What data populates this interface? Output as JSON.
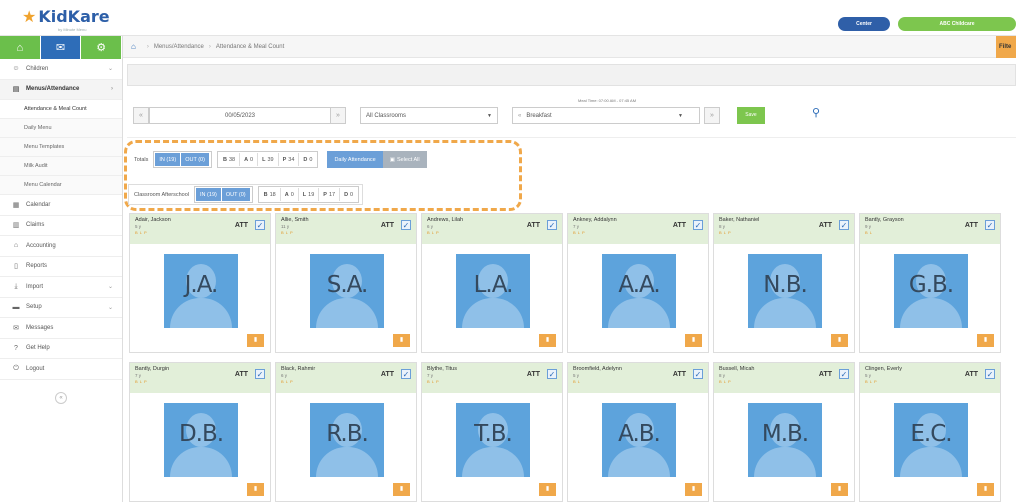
{
  "header": {
    "logo": "KidKare",
    "logo_sub": "by Minute Menu",
    "center_pill": "Center",
    "provider_pill": "ABC Childcare"
  },
  "sidebar": {
    "tabs": [
      {
        "icon": "home-icon",
        "glyph": "⌂"
      },
      {
        "icon": "mail-icon",
        "glyph": "✉"
      },
      {
        "icon": "gears-icon",
        "glyph": "⚙"
      }
    ],
    "items": [
      {
        "label": "Children",
        "icon": "child-icon",
        "glyph": "☺",
        "has_chevron": true
      },
      {
        "label": "Menus/Attendance",
        "icon": "menu-icon",
        "glyph": "▤",
        "has_chevron": true,
        "active": true
      },
      {
        "label": "Calendar",
        "icon": "calendar-icon",
        "glyph": "▦",
        "has_chevron": false
      },
      {
        "label": "Claims",
        "icon": "claims-icon",
        "glyph": "▥",
        "has_chevron": false
      },
      {
        "label": "Accounting",
        "icon": "bank-icon",
        "glyph": "⌂",
        "has_chevron": false
      },
      {
        "label": "Reports",
        "icon": "report-icon",
        "glyph": "▯",
        "has_chevron": false
      },
      {
        "label": "Import",
        "icon": "import-icon",
        "glyph": "⤓",
        "has_chevron": true
      },
      {
        "label": "Setup",
        "icon": "setup-icon",
        "glyph": "▬",
        "has_chevron": true
      },
      {
        "label": "Messages",
        "icon": "messages-icon",
        "glyph": "✉",
        "has_chevron": false
      },
      {
        "label": "Get Help",
        "icon": "help-icon",
        "glyph": "?",
        "has_chevron": false
      },
      {
        "label": "Logout",
        "icon": "logout-icon",
        "glyph": "⏻",
        "has_chevron": false
      }
    ],
    "sub_items": [
      {
        "label": "Attendance & Meal Count",
        "active": true
      },
      {
        "label": "Daily Menu"
      },
      {
        "label": "Menu Templates"
      },
      {
        "label": "Milk Audit"
      },
      {
        "label": "Menu Calendar"
      }
    ]
  },
  "breadcrumb": {
    "items": [
      "Menus/Attendance",
      "Attendance & Meal Count"
    ],
    "filter_label": "Filte"
  },
  "controls": {
    "date": "00/05/2023",
    "classroom": "All Classrooms",
    "meal": "Breakfast",
    "meal_time": "Meal Time: 07:00 AM - 07:45 AM",
    "save_label": "Save"
  },
  "totals": {
    "label": "Totals",
    "in": "IN (19)",
    "out": "OUT (0)",
    "counts": [
      {
        "k": "B",
        "v": "38"
      },
      {
        "k": "A",
        "v": "0"
      },
      {
        "k": "L",
        "v": "39"
      },
      {
        "k": "P",
        "v": "34"
      },
      {
        "k": "D",
        "v": "0"
      }
    ],
    "daily_attendance": "Daily Attendance",
    "select_all": "Select All"
  },
  "classroom_row": {
    "label": "Classroom Afterschool",
    "in": "IN (19)",
    "out": "OUT (0)",
    "counts": [
      {
        "k": "B",
        "v": "18"
      },
      {
        "k": "A",
        "v": "0"
      },
      {
        "k": "L",
        "v": "19"
      },
      {
        "k": "P",
        "v": "17"
      },
      {
        "k": "D",
        "v": "0"
      }
    ]
  },
  "children": [
    {
      "name": "Adair, Jackson",
      "age": "5 y",
      "tags": "B L P",
      "initials": "J.A."
    },
    {
      "name": "Allie, Smith",
      "age": "11 y",
      "tags": "B L P",
      "initials": "S.A."
    },
    {
      "name": "Andrews, Lilah",
      "age": "6 y",
      "tags": "B L P",
      "initials": "L.A."
    },
    {
      "name": "Ankney, Addalynn",
      "age": "7 y",
      "tags": "B L P",
      "initials": "A.A."
    },
    {
      "name": "Baker, Nathaniel",
      "age": "8 y",
      "tags": "B L P",
      "initials": "N.B."
    },
    {
      "name": "Bantly, Grayson",
      "age": "9 y",
      "tags": "B L",
      "initials": "G.B."
    },
    {
      "name": "Bantly, Durgin",
      "age": "7 y",
      "tags": "B L P",
      "initials": "D.B."
    },
    {
      "name": "Black, Rahmir",
      "age": "6 y",
      "tags": "B L P",
      "initials": "R.B."
    },
    {
      "name": "Blythe, Titus",
      "age": "7 y",
      "tags": "B L P",
      "initials": "T.B."
    },
    {
      "name": "Broomfield, Adelynn",
      "age": "5 y",
      "tags": "B L",
      "initials": "A.B."
    },
    {
      "name": "Bussell, Micah",
      "age": "8 y",
      "tags": "B L P",
      "initials": "M.B."
    },
    {
      "name": "Clingen, Everly",
      "age": "5 y",
      "tags": "B L P",
      "initials": "E.C."
    }
  ],
  "att_label": "ATT",
  "colors": {
    "green": "#7dc64e",
    "blue": "#2e6db8",
    "orange": "#f0a84a",
    "card_head": "#e2efd9"
  }
}
